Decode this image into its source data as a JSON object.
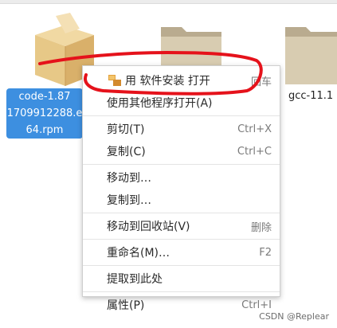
{
  "files": {
    "pkg": {
      "label_lines": [
        "code-1.87",
        "1709912288.e",
        "64.rpm"
      ],
      "icon": "package-box-icon"
    },
    "folder1": {
      "icon": "folder-icon"
    },
    "folder2": {
      "label": "gcc-11.1",
      "icon": "folder-icon"
    }
  },
  "menu": {
    "items": [
      {
        "label": "用 软件安装 打开",
        "accel": "回车",
        "icon": "software-install-icon"
      },
      {
        "label": "使用其他程序打开(A)",
        "accel": ""
      },
      {
        "label": "剪切(T)",
        "accel": "Ctrl+X"
      },
      {
        "label": "复制(C)",
        "accel": "Ctrl+C"
      },
      {
        "label": "移动到…",
        "accel": ""
      },
      {
        "label": "复制到…",
        "accel": ""
      },
      {
        "label": "移动到回收站(V)",
        "accel": "删除"
      },
      {
        "label": "重命名(M)…",
        "accel": "F2"
      },
      {
        "label": "提取到此处",
        "accel": ""
      },
      {
        "label": "属性(P)",
        "accel": "Ctrl+I"
      }
    ]
  },
  "annotation": {
    "color": "#e5121b"
  },
  "watermark": "CSDN @Replear"
}
